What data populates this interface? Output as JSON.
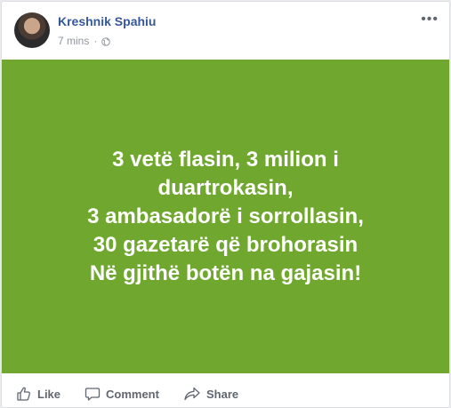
{
  "post": {
    "author": "Kreshnik Spahiu",
    "time": "7 mins",
    "separator": "·",
    "privacy_icon": "globe-icon",
    "more_label": "•••",
    "background_color": "#6fa72f",
    "status_lines": [
      "3 vetë flasin, 3 milion i duartrokasin,",
      "3 ambasadorë i sorrollasin,",
      "30 gazetarë që brohorasin",
      "Në gjithë botën na gajasin!"
    ]
  },
  "actions": {
    "like_label": "Like",
    "like_icon": "thumbs-up-icon",
    "comment_label": "Comment",
    "comment_icon": "speech-bubble-icon",
    "share_label": "Share",
    "share_icon": "share-arrow-icon"
  }
}
